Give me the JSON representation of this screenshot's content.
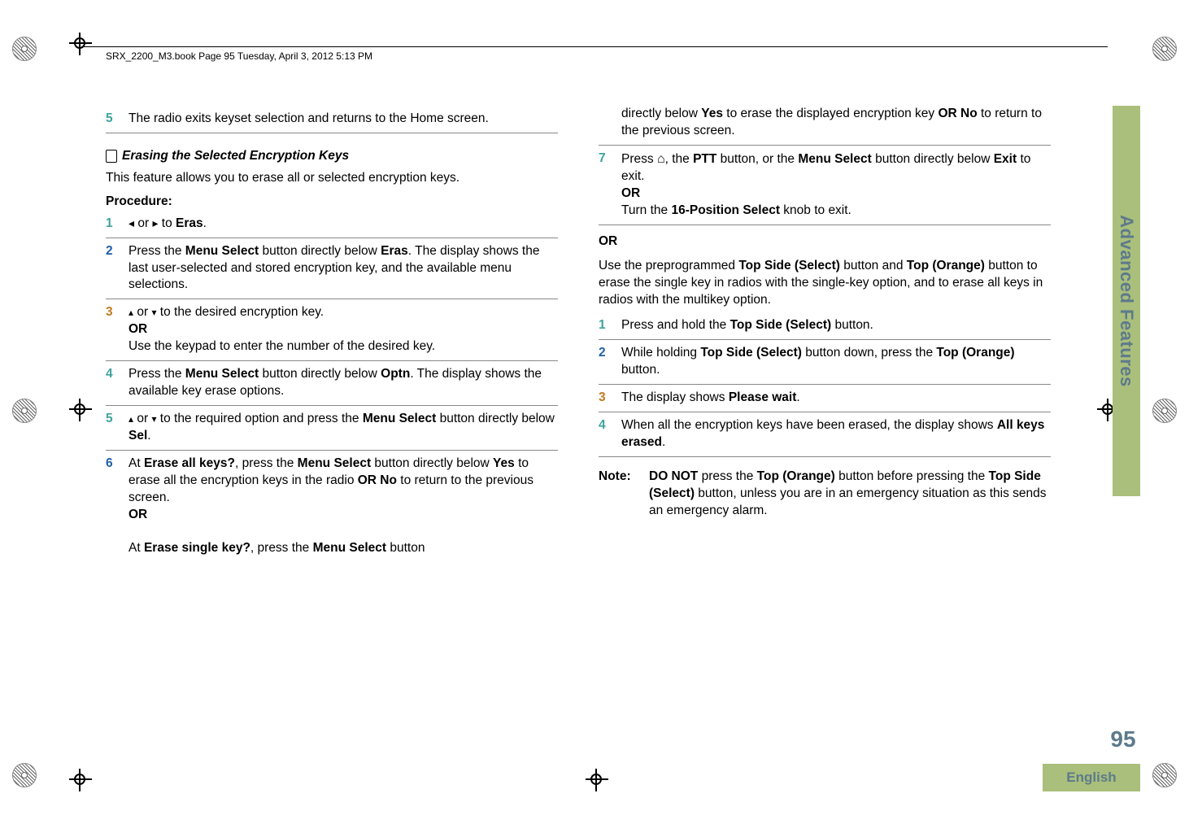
{
  "header": "SRX_2200_M3.book  Page 95  Tuesday, April 3, 2012  5:13 PM",
  "side_tab": "Advanced Features",
  "page_number": "95",
  "language": "English",
  "left": {
    "step5_top": "The radio exits keyset selection and returns to the Home screen.",
    "subheading": "Erasing the Selected Encryption Keys",
    "intro": "This feature allows you to erase all or selected encryption keys.",
    "procedure_label": "Procedure:",
    "s1_a": " or ",
    "s1_b": " to ",
    "s1_menu": "Eras",
    "s1_end": ".",
    "s2_a": "Press the ",
    "s2_b": "Menu Select",
    "s2_c": " button directly below ",
    "s2_menu": "Eras",
    "s2_d": ". The display shows the last user-selected and stored encryption key, and the available menu selections.",
    "s3_a": " or ",
    "s3_b": " to the desired encryption key.",
    "s3_or": "OR",
    "s3_c": "Use the keypad to enter the number of the desired key.",
    "s4_a": "Press the ",
    "s4_b": "Menu Select",
    "s4_c": " button directly below ",
    "s4_menu": "Optn",
    "s4_d": ". The display shows the available key erase options.",
    "s5_a": " or ",
    "s5_b": " to the required option and press the ",
    "s5_c": "Menu Select",
    "s5_d": " button directly below ",
    "s5_menu": "Sel",
    "s5_e": ".",
    "s6_a": "At ",
    "s6_menu1": "Erase all keys?",
    "s6_b": ", press the ",
    "s6_c": "Menu Select",
    "s6_d": " button directly below ",
    "s6_yes": "Yes",
    "s6_e": " to erase all the encryption keys in the radio ",
    "s6_or1": "OR",
    "s6_no": " No",
    "s6_f": " to return to the previous screen.",
    "s6_or2": "OR",
    "s6_g": "At ",
    "s6_menu2": "Erase single key?",
    "s6_h": ", press the ",
    "s6_i": "Menu Select",
    "s6_j": " button"
  },
  "right": {
    "cont_a": "directly below ",
    "cont_yes": "Yes",
    "cont_b": " to erase the displayed encryption key ",
    "cont_or": "OR",
    "cont_no": " No",
    "cont_c": " to return to the previous screen.",
    "s7_a": "Press ",
    "s7_b": ", the ",
    "s7_ptt": "PTT",
    "s7_c": " button, or the ",
    "s7_ms": "Menu Select",
    "s7_d": " button directly below ",
    "s7_exit": "Exit",
    "s7_e": " to exit.",
    "s7_or": "OR",
    "s7_f": "Turn the ",
    "s7_knob": "16-Position Select",
    "s7_g": " knob to exit.",
    "big_or": "OR",
    "para2_a": "Use the preprogrammed ",
    "para2_b": "Top Side (Select)",
    "para2_c": " button and ",
    "para2_d": "Top (Orange)",
    "para2_e": " button to erase the single key in radios with the single-key option, and to erase all keys in radios with the multikey option.",
    "r1_a": "Press and hold the ",
    "r1_b": "Top Side (Select)",
    "r1_c": " button.",
    "r2_a": "While holding ",
    "r2_b": "Top Side (Select)",
    "r2_c": " button down, press the ",
    "r2_d": "Top (Orange)",
    "r2_e": " button.",
    "r3_a": "The display shows ",
    "r3_menu": "Please wait",
    "r3_b": ".",
    "r4_a": "When all the encryption keys have been erased, the display shows ",
    "r4_menu": "All keys erased",
    "r4_b": ".",
    "note_label": "Note:",
    "note_a": "DO NOT",
    "note_b": " press the ",
    "note_c": "Top (Orange)",
    "note_d": " button before pressing the ",
    "note_e": "Top Side (Select)",
    "note_f": " button, unless you are in an emergency situation as this sends an emergency alarm."
  },
  "step_colors": {
    "n5": "c-teal",
    "n1": "c-teal",
    "n2": "c-blue",
    "n3": "c-orange",
    "n4": "c-teal",
    "n5b": "c-teal",
    "n6": "c-blue",
    "n7": "c-teal"
  }
}
